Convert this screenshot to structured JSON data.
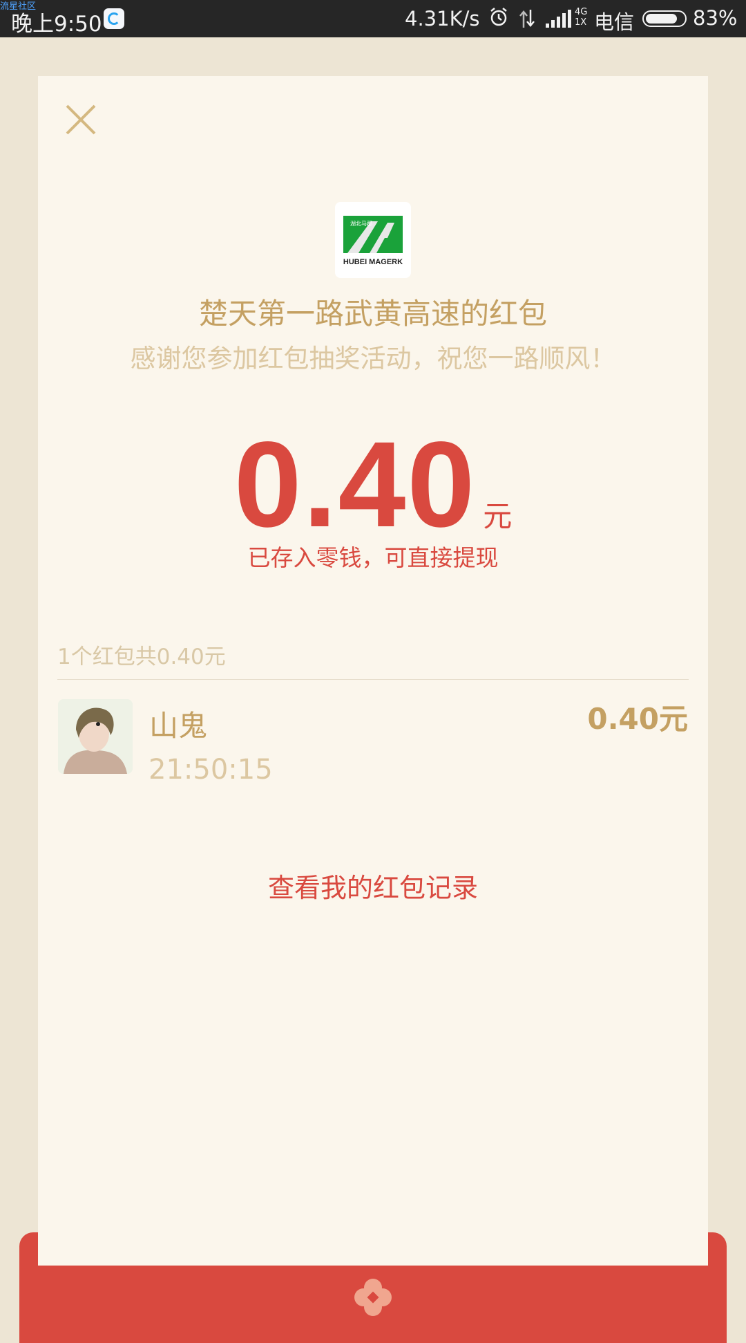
{
  "status_bar": {
    "watermark": "流星社区",
    "time": "晚上9:50",
    "app_icon": "qq-browser-icon",
    "speed": "4.31K/s",
    "alarm_icon": "alarm-icon",
    "data_icon": "data-transfer-icon",
    "signal_icon": "signal-icon",
    "network_top": "4G",
    "network_bottom": "1X",
    "carrier": "电信",
    "battery_level": 0.83,
    "battery_pct": "83%"
  },
  "card": {
    "close_icon": "close-icon",
    "logo_icon": "hubei-mager-logo",
    "logo_top_text": "湖北马郡",
    "logo_bottom_text": "HUBEI MAGERK",
    "title": "楚天第一路武黄高速的红包",
    "subtitle": "感谢您参加红包抽奖活动，祝您一路顺风！",
    "amount": "0.40",
    "amount_unit": "元",
    "stored_note": "已存入零钱，可直接提现",
    "summary": "1个红包共0.40元",
    "record": {
      "name": "山鬼",
      "time": "21:50:15",
      "amount": "0.40元"
    },
    "history_link": "查看我的红包记录"
  },
  "colors": {
    "accent_red": "#d9493f",
    "gold": "#c4a062",
    "light_gold": "#dcc7a1",
    "card_bg": "#fbf6ec",
    "page_bg": "#ede5d4"
  },
  "envelope": {
    "flower_icon": "flower-icon"
  }
}
